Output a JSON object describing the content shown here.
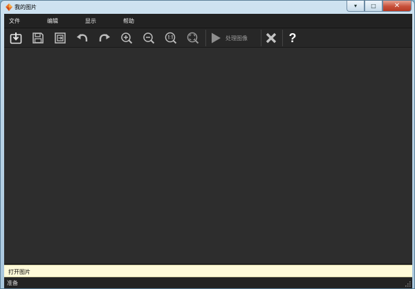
{
  "window": {
    "title": "我的图片",
    "caption_buttons": {
      "minimize": "▾",
      "maximize": "□",
      "close": "✕"
    }
  },
  "menubar": {
    "items": [
      {
        "label": "文件"
      },
      {
        "label": "编辑"
      },
      {
        "label": "显示"
      },
      {
        "label": "帮助"
      }
    ]
  },
  "toolbar": {
    "icons": [
      "open-icon",
      "save-icon",
      "export-icon",
      "undo-icon",
      "redo-icon",
      "zoom-in-icon",
      "zoom-out-icon",
      "actual-size-icon",
      "fit-window-icon",
      "play-icon",
      "close-x-icon"
    ],
    "process_label": "处理图像",
    "help_label": "?"
  },
  "hint": {
    "text": "打开图片"
  },
  "status": {
    "text": "准备"
  },
  "colors": {
    "background": "#2c2c2c",
    "menubar": "#222222",
    "hint_bar": "#fefad9",
    "icon": "#d8d8d8"
  }
}
